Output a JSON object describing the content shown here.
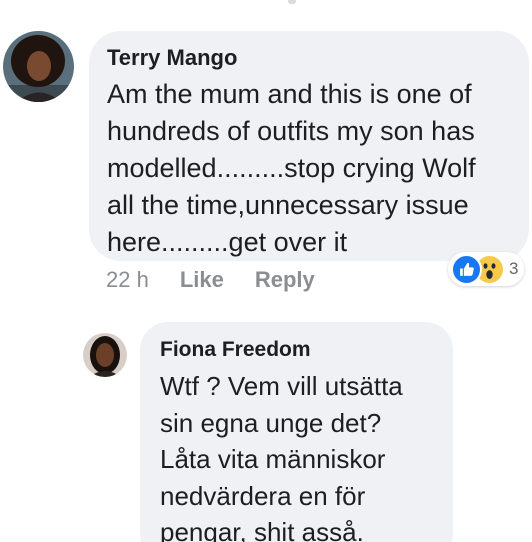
{
  "comments": [
    {
      "author": "Terry Mango",
      "text_lines": [
        "Am the mum and this is one of",
        "hundreds of outfits my son has",
        "modelled.........stop crying Wolf",
        "all the time,unnecessary issue",
        "here.........get over it"
      ],
      "time": "22 h",
      "like_label": "Like",
      "reply_label": "Reply",
      "reactions": {
        "icons": [
          "like-icon",
          "wow-icon"
        ],
        "count": "3",
        "like_color": "#1877f2",
        "wow_color": "#f7c94a"
      }
    },
    {
      "author": "Fiona Freedom",
      "text_lines": [
        "Wtf ? Vem vill utsätta",
        "sin egna unge det?",
        "Låta vita människor",
        "nedvärdera en för",
        "pengar, shit asså."
      ]
    }
  ],
  "colors": {
    "bubble": "#f0f1f4",
    "text": "#1c1e21",
    "meta": "#8a8d91"
  }
}
